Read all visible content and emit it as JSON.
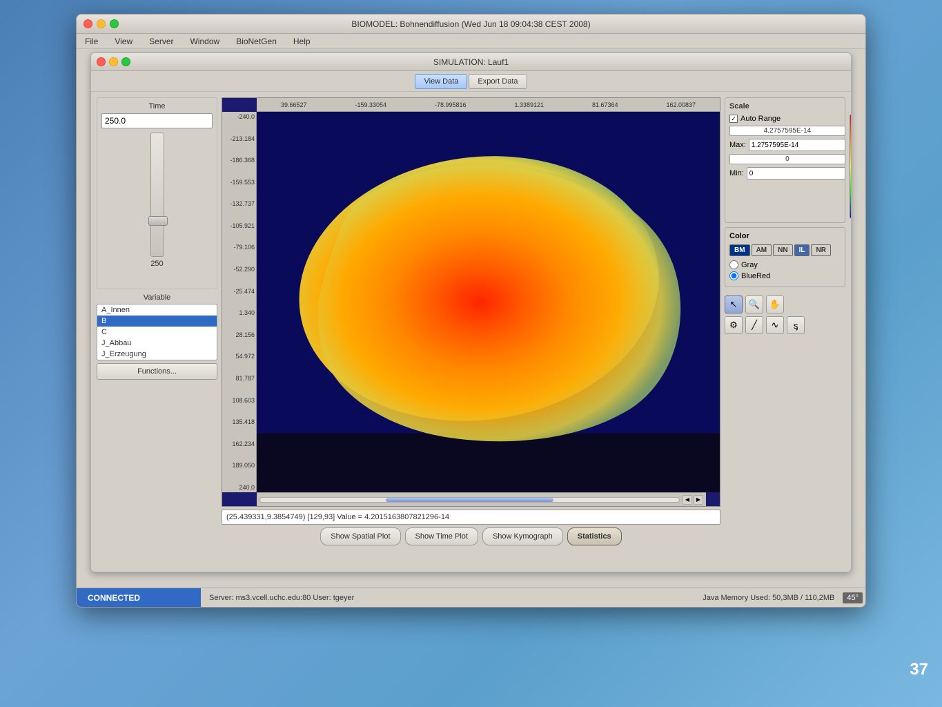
{
  "outer_window": {
    "title": "BIOMODEL: Bohnendiffusion (Wed Jun 18 09:04:38 CEST 2008)",
    "traffic_lights": [
      "red",
      "yellow",
      "green"
    ]
  },
  "menu": {
    "items": [
      "File",
      "View",
      "Server",
      "Window",
      "BioNetGen",
      "Help"
    ]
  },
  "inner_window": {
    "title": "SIMULATION: Lauf1"
  },
  "toolbar": {
    "view_data": "View Data",
    "export_data": "Export Data"
  },
  "time_panel": {
    "label": "Time",
    "value": "250.0",
    "slider_min": "0",
    "slider_max": "250"
  },
  "variable_panel": {
    "label": "Variable",
    "items": [
      "A_Innen",
      "B",
      "C",
      "J_Abbau",
      "J_Erzeugung"
    ],
    "selected": "B"
  },
  "functions_btn": "Functions...",
  "axis_top": {
    "labels": [
      "39.66527",
      "-159.33054",
      "-78.995816",
      "1.3389121",
      "81.67364",
      "162.00837"
    ]
  },
  "axis_left": {
    "labels": [
      "-240.0",
      "-213.184",
      "-186.368",
      "-159.553",
      "-132.737",
      "-105.921",
      "-79.106",
      "-52.290",
      "-25.474",
      "1.340",
      "28.156",
      "54.972",
      "81.787",
      "108.603",
      "135.418",
      "162.234",
      "189.050",
      "240.0"
    ]
  },
  "status_inner": {
    "text": "(25.439331,9.3854749) [129,93] Value = 4.2015163807821296-14"
  },
  "bottom_buttons": {
    "spatial": "Show Spatial Plot",
    "time": "Show Time Plot",
    "kymograph": "Show Kymograph",
    "statistics": "Statistics"
  },
  "scale": {
    "header": "Scale",
    "auto_range_label": "Auto Range",
    "value1": "4.2757595E-14",
    "max_label": "Max:",
    "max_value": "1.2757595E-14",
    "min_zero": "0",
    "min_label": "Min:",
    "min_value": "0"
  },
  "color": {
    "header": "Color",
    "buttons": [
      "BM",
      "AM",
      "NN",
      "IL",
      "NR"
    ],
    "gray_label": "Gray",
    "bluered_label": "BlueRed",
    "selected": "BlueRed"
  },
  "statusbar": {
    "connected": "CONNECTED",
    "server": "Server: ms3.vcell.uchc.edu:80 User: tgeyer",
    "memory": "Java Memory Used: 50,3MB / 110,2MB",
    "num_badge": "45°"
  },
  "page_number": "37"
}
